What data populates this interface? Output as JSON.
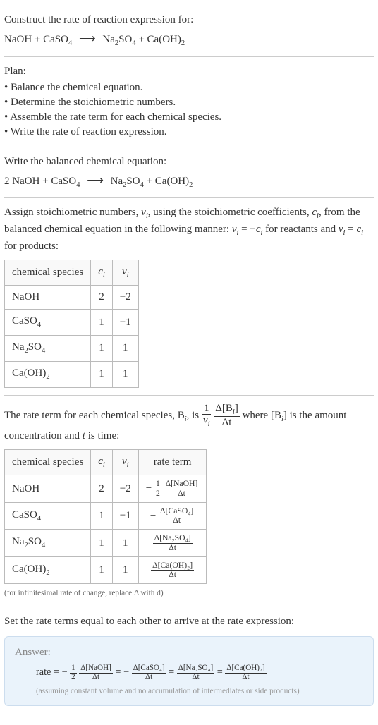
{
  "intro": {
    "title": "Construct the rate of reaction expression for:",
    "reactant1": "NaOH",
    "plus1": " + ",
    "reactant2": "CaSO",
    "reactant2_sub": "4",
    "arrow": "⟶",
    "product1": "Na",
    "product1_sub1": "2",
    "product1_mid": "SO",
    "product1_sub2": "4",
    "plus2": " + ",
    "product2": "Ca(OH)",
    "product2_sub": "2"
  },
  "plan": {
    "heading": "Plan:",
    "items": [
      "Balance the chemical equation.",
      "Determine the stoichiometric numbers.",
      "Assemble the rate term for each chemical species.",
      "Write the rate of reaction expression."
    ]
  },
  "balanced": {
    "heading": "Write the balanced chemical equation:",
    "coef1": "2 ",
    "r1": "NaOH",
    "plus1": " + ",
    "r2": "CaSO",
    "r2_sub": "4",
    "arrow": "⟶",
    "p1": "Na",
    "p1_sub1": "2",
    "p1_mid": "SO",
    "p1_sub2": "4",
    "plus2": " + ",
    "p2": "Ca(OH)",
    "p2_sub": "2"
  },
  "stoich": {
    "text1": "Assign stoichiometric numbers, ",
    "nu": "ν",
    "sub_i": "i",
    "text2": ", using the stoichiometric coefficients, ",
    "c": "c",
    "text3": ", from the balanced chemical equation in the following manner: ",
    "eq1_lhs": "ν",
    "eq1_eq": " = −",
    "eq1_rhs": "c",
    "text4": " for reactants and ",
    "eq2_lhs": "ν",
    "eq2_eq": " = ",
    "eq2_rhs": "c",
    "text5": " for products:",
    "table": {
      "h1": "chemical species",
      "h2": "c",
      "h2_sub": "i",
      "h3": "ν",
      "h3_sub": "i",
      "rows": [
        {
          "sp": "NaOH",
          "sp_sub": "",
          "c": "2",
          "nu": "−2"
        },
        {
          "sp": "CaSO",
          "sp_sub": "4",
          "c": "1",
          "nu": "−1"
        },
        {
          "sp": "Na",
          "sp_sub1": "2",
          "sp_mid": "SO",
          "sp_sub2": "4",
          "c": "1",
          "nu": "1"
        },
        {
          "sp": "Ca(OH)",
          "sp_sub": "2",
          "c": "1",
          "nu": "1"
        }
      ]
    }
  },
  "rateterm": {
    "text1": "The rate term for each chemical species, B",
    "sub_i": "i",
    "text2": ", is ",
    "frac1_num": "1",
    "frac1_den_sym": "ν",
    "frac1_den_sub": "i",
    "frac2_num_d": "Δ[B",
    "frac2_num_sub": "i",
    "frac2_num_close": "]",
    "frac2_den": "Δt",
    "text3": " where [B",
    "text4": "] is the amount concentration and ",
    "t": "t",
    "text5": " is time:",
    "table": {
      "h1": "chemical species",
      "h2": "c",
      "h2_sub": "i",
      "h3": "ν",
      "h3_sub": "i",
      "h4": "rate term",
      "rows": [
        {
          "sp": "NaOH",
          "c": "2",
          "nu": "−2",
          "neg": "− ",
          "half_num": "1",
          "half_den": "2",
          "num": "Δ[NaOH]",
          "den": "Δt"
        },
        {
          "sp": "CaSO",
          "sp_sub": "4",
          "c": "1",
          "nu": "−1",
          "neg": "− ",
          "num": "Δ[CaSO₄]",
          "den": "Δt"
        },
        {
          "sp": "Na",
          "sp_sub1": "2",
          "sp_mid": "SO",
          "sp_sub2": "4",
          "c": "1",
          "nu": "1",
          "num": "Δ[Na₂SO₄]",
          "den": "Δt"
        },
        {
          "sp": "Ca(OH)",
          "sp_sub": "2",
          "c": "1",
          "nu": "1",
          "num": "Δ[Ca(OH)₂]",
          "den": "Δt"
        }
      ]
    },
    "note": "(for infinitesimal rate of change, replace Δ with d)"
  },
  "final": {
    "heading": "Set the rate terms equal to each other to arrive at the rate expression:",
    "answer_label": "Answer:",
    "rate": "rate = − ",
    "half_num": "1",
    "half_den": "2",
    "t1_num": "Δ[NaOH]",
    "t1_den": "Δt",
    "eq1": " = − ",
    "t2_num": "Δ[CaSO₄]",
    "t2_den": "Δt",
    "eq2": " = ",
    "t3_num": "Δ[Na₂SO₄]",
    "t3_den": "Δt",
    "eq3": " = ",
    "t4_num": "Δ[Ca(OH)₂]",
    "t4_den": "Δt",
    "note": "(assuming constant volume and no accumulation of intermediates or side products)"
  }
}
